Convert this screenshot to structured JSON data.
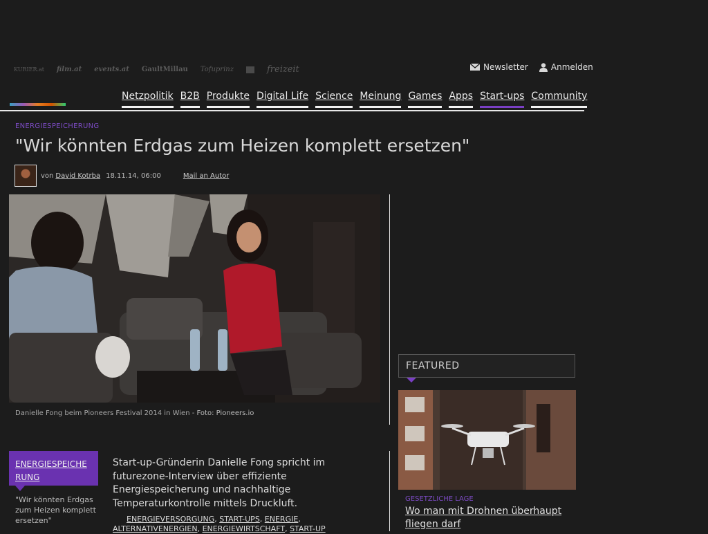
{
  "partners": [
    "KURIER.at",
    "film.at",
    "events.at",
    "GaultMillau",
    "Tofuprinz",
    "",
    "freizeit"
  ],
  "top_actions": {
    "newsletter": "Newsletter",
    "login": "Anmelden"
  },
  "nav": {
    "items": [
      "Netzpolitik",
      "B2B",
      "Produkte",
      "Digital Life",
      "Science",
      "Meinung",
      "Games",
      "Apps",
      "Start-ups",
      "Community"
    ],
    "active": "Start-ups"
  },
  "article": {
    "kicker": "ENERGIESPEICHERUNG",
    "headline": "\"Wir könnten Erdgas zum Heizen komplett ersetzen\"",
    "byline_prefix": "von",
    "author": "David Kotrba",
    "date": "18.11.14, 06:00",
    "mail_author": "Mail an Autor",
    "caption_text": "Danielle Fong beim Pioneers Festival 2014 in Wien - ",
    "caption_credit": "Foto: Pioneers.io",
    "lead": "Start-up-Gründerin Danielle Fong spricht im futurezone-Interview über effiziente Energiespeicherung und nachhaltige Temperaturkontrolle mittels Druckluft.",
    "tags": [
      "ENERGIEVERSORGUNG",
      "START-UPS",
      "ENERGIE",
      "ALTERNATIVENERGIEN",
      "ENERGIEWIRTSCHAFT",
      "START-UP"
    ]
  },
  "sidebar_box": {
    "label": "ENERGIESPEICHERUNG",
    "quote": "\"Wir könnten Erdgas zum Heizen komplett ersetzen\""
  },
  "featured": {
    "heading": "FEATURED",
    "kicker": "GESETZLICHE LAGE",
    "title": "Wo man mit Drohnen überhaupt fliegen darf"
  },
  "colors": {
    "accent": "#7a3fc4",
    "background": "#1c1c1c"
  }
}
